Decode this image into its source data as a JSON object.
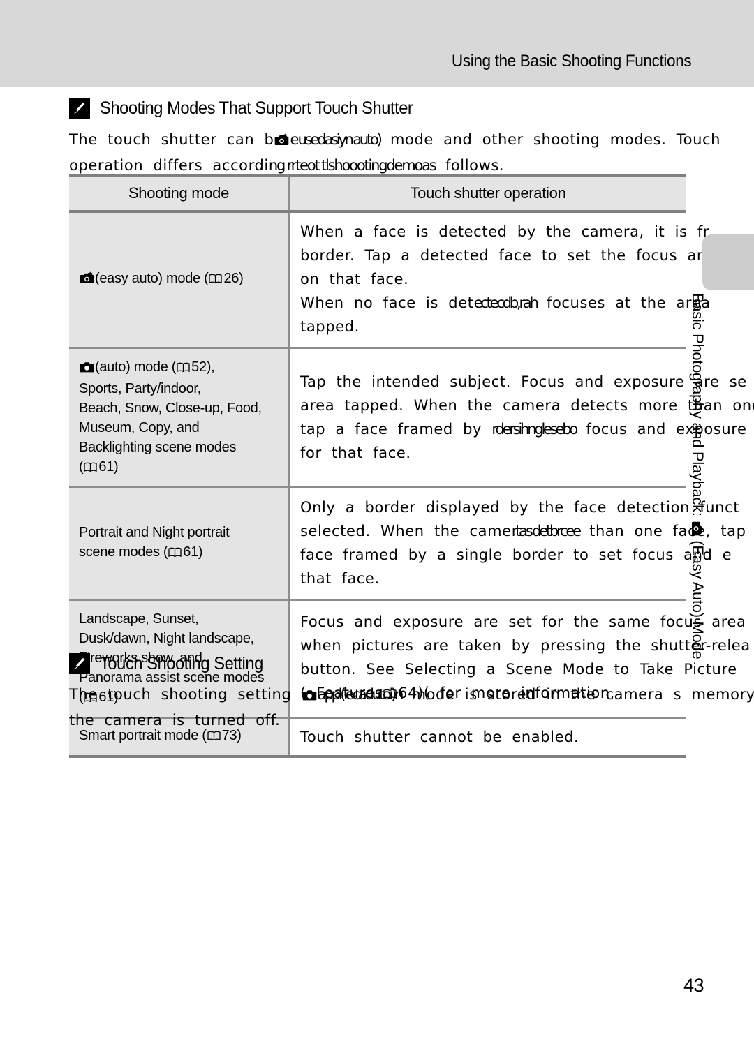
{
  "header": {
    "title": "Using the Basic Shooting Functions"
  },
  "sections": [
    {
      "icon": "pencil-note-icon",
      "heading": "Shooting Modes That Support Touch Shutter",
      "paragraph_lines": [
        {
          "pre": "The   touch   shutter   can   b",
          "icon": "easy-auto-camera-icon",
          "overlap": "e usedasiyn auto)",
          "post": "   mode  and  other   shooting  modes.   Touch"
        },
        {
          "pre": "operation  differs   accordi",
          "overlap": "ng rrteot tlshoootingdemoas",
          "post": "  follows."
        }
      ]
    },
    {
      "icon": "pencil-note-icon",
      "heading": "Touch Shooting Setting",
      "paragraph_lines": [
        {
          "pre": "The   touch   shooting   setting   ",
          "icon": "auto-camera-icon",
          "overlap": "appl(iecadutoi)n",
          "post": "   mode  is  stored  in  the  camera s  memory"
        },
        {
          "pre": "the  camera  is  turned  off.",
          "overlap": "",
          "post": ""
        }
      ]
    }
  ],
  "table": {
    "headers": {
      "left": "Shooting mode",
      "right": "Touch shutter operation"
    },
    "rows": [
      {
        "id": "easy-auto",
        "left_icon": "easy-auto-camera-icon",
        "left_lines": [
          "(easy auto) mode (",
          "26)"
        ],
        "left_text": " (easy auto) mode (☐ 26)",
        "ref_page": "26",
        "right_lines": [
          "When  a  face  is  detected  by  the  camera,  it  is  fr",
          "border.  Tap  a  detected  face  to  set  the  focus  and",
          "on  that  face.",
          "When  no  face  is  detected|camera|focuses  at  the  area",
          "tapped."
        ]
      },
      {
        "id": "auto-and-scene-modes",
        "left_icon": "auto-camera-icon",
        "left_lines": [
          " (auto) mode (☐ 52),",
          "Sports, Party/indoor,",
          "Beach, Snow, Close-up, Food,",
          "Museum, Copy, and",
          "Backlighting scene modes",
          "(☐ 61)"
        ],
        "right_lines": [
          "Tap  the  intended  subject.   Focus  and  exposure  are  se",
          "area  tapped.  When  the  camera  detects  more  than  one",
          "tap  a  face  framed  by  a|single|border to  focus  and  exposure",
          "for  that  face."
        ]
      },
      {
        "id": "portrait-night-portrait",
        "left_icon": null,
        "left_lines": [
          "Portrait and Night portrait",
          "scene modes (☐ 61)"
        ],
        "right_lines": [
          "Only  a  border  displayed  by  the  face  detection funct",
          "selected.  When  the  camera|detects|more  than  one  face, tap",
          "face  framed  by  a  single  border  to  set  focus  and  e",
          "that  face."
        ]
      },
      {
        "id": "landscape-sunset",
        "left_icon": null,
        "left_lines": [
          "Landscape, Sunset,",
          "Dusk/dawn, Night landscape,",
          "Fireworks show, and",
          "Panorama assist scene modes",
          "(☐ 61)"
        ],
        "right_lines": [
          "Focus  and  exposure  are  set  for  the  same  focus  area",
          "when  pictures  are  taken  by  pressing  the  shutter-relea",
          "button.  See  Selecting  a  Scene  Mode  to  Take  Picture",
          "( Features|64)(   for  more  information."
        ]
      },
      {
        "id": "smart-portrait",
        "left_icon": null,
        "left_lines": [
          "Smart portrait mode (☐ 73)"
        ],
        "right_lines": [
          "Touch   shutter   cannot   be   enabled."
        ]
      }
    ]
  },
  "side_tab": {
    "label": "Basic Photography and Playback:  (Easy Auto) Mode"
  },
  "page_number": "43",
  "colors": {
    "header_band": "#d8d8d8",
    "table_header_fill": "#e4e4e4",
    "table_rule": "#8c8c8c",
    "side_tab_fill": "#cdcdcd",
    "text": "#000000"
  }
}
